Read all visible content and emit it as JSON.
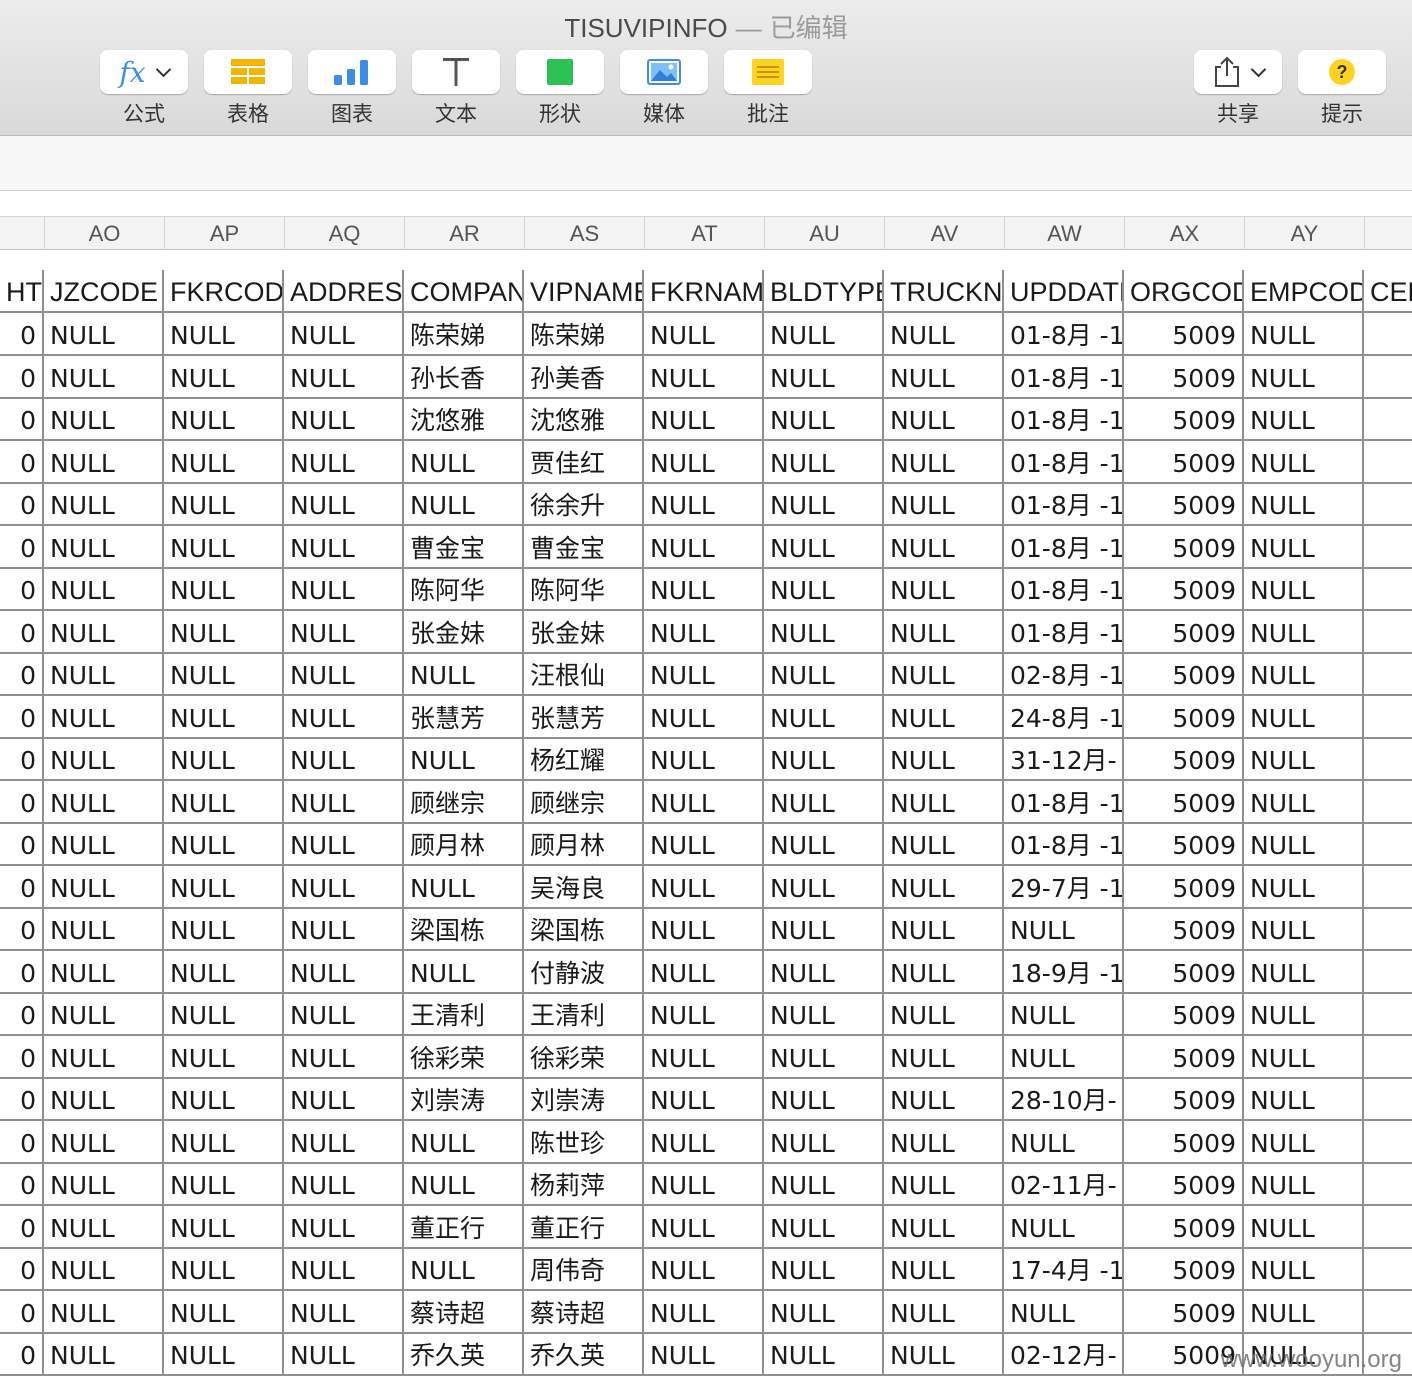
{
  "window": {
    "title": "TISUVIPINFO",
    "separator": "—",
    "status": "已编辑"
  },
  "toolbar": {
    "formula": {
      "icon": "fx-icon",
      "glyph": "fx",
      "label": "公式"
    },
    "table": {
      "icon": "table-icon",
      "label": "表格"
    },
    "chart": {
      "icon": "chart-icon",
      "label": "图表"
    },
    "text": {
      "icon": "text-icon",
      "glyph": "T",
      "label": "文本"
    },
    "shape": {
      "icon": "shape-icon",
      "label": "形状"
    },
    "media": {
      "icon": "media-icon",
      "label": "媒体"
    },
    "comment": {
      "icon": "comment-icon",
      "label": "批注"
    },
    "share": {
      "icon": "share-icon",
      "label": "共享"
    },
    "tips": {
      "icon": "help-icon",
      "glyph": "?",
      "label": "提示"
    }
  },
  "colors": {
    "accent_blue": "#3b8de8",
    "table_orange": "#f5b400",
    "shape_green": "#2ec255",
    "comment_yellow": "#ffd21f",
    "tips_yellow": "#ffd21f"
  },
  "column_letters": [
    "AO",
    "AP",
    "AQ",
    "AR",
    "AS",
    "AT",
    "AU",
    "AV",
    "AW",
    "AX",
    "AY",
    ""
  ],
  "table": {
    "headers": [
      "HT",
      "JZCODE",
      "FKRCODE",
      "ADDRESS",
      "COMPANY",
      "VIPNAME",
      "FKRNAME",
      "BLDTYPE",
      "TRUCKNO",
      "UPDDATE",
      "ORGCODE",
      "EMPCODE",
      "CER"
    ],
    "rows": [
      [
        "0",
        "NULL",
        "NULL",
        "NULL",
        "陈荣娣",
        "陈荣娣",
        "NULL",
        "NULL",
        "NULL",
        "01-8月 -1",
        "5009",
        "NULL",
        ""
      ],
      [
        "0",
        "NULL",
        "NULL",
        "NULL",
        "孙长香",
        "孙美香",
        "NULL",
        "NULL",
        "NULL",
        "01-8月 -1",
        "5009",
        "NULL",
        ""
      ],
      [
        "0",
        "NULL",
        "NULL",
        "NULL",
        "沈悠雅",
        "沈悠雅",
        "NULL",
        "NULL",
        "NULL",
        "01-8月 -1",
        "5009",
        "NULL",
        ""
      ],
      [
        "0",
        "NULL",
        "NULL",
        "NULL",
        "NULL",
        "贾佳红",
        "NULL",
        "NULL",
        "NULL",
        "01-8月 -1",
        "5009",
        "NULL",
        ""
      ],
      [
        "0",
        "NULL",
        "NULL",
        "NULL",
        "NULL",
        "徐余升",
        "NULL",
        "NULL",
        "NULL",
        "01-8月 -1",
        "5009",
        "NULL",
        ""
      ],
      [
        "0",
        "NULL",
        "NULL",
        "NULL",
        "曹金宝",
        "曹金宝",
        "NULL",
        "NULL",
        "NULL",
        "01-8月 -1",
        "5009",
        "NULL",
        ""
      ],
      [
        "0",
        "NULL",
        "NULL",
        "NULL",
        "陈阿华",
        "陈阿华",
        "NULL",
        "NULL",
        "NULL",
        "01-8月 -1",
        "5009",
        "NULL",
        ""
      ],
      [
        "0",
        "NULL",
        "NULL",
        "NULL",
        "张金妹",
        "张金妹",
        "NULL",
        "NULL",
        "NULL",
        "01-8月 -1",
        "5009",
        "NULL",
        ""
      ],
      [
        "0",
        "NULL",
        "NULL",
        "NULL",
        "NULL",
        "汪根仙",
        "NULL",
        "NULL",
        "NULL",
        "02-8月 -1",
        "5009",
        "NULL",
        ""
      ],
      [
        "0",
        "NULL",
        "NULL",
        "NULL",
        "张慧芳",
        "张慧芳",
        "NULL",
        "NULL",
        "NULL",
        "24-8月 -1",
        "5009",
        "NULL",
        ""
      ],
      [
        "0",
        "NULL",
        "NULL",
        "NULL",
        "NULL",
        "杨红耀",
        "NULL",
        "NULL",
        "NULL",
        "31-12月-",
        "5009",
        "NULL",
        ""
      ],
      [
        "0",
        "NULL",
        "NULL",
        "NULL",
        "顾继宗",
        "顾继宗",
        "NULL",
        "NULL",
        "NULL",
        "01-8月 -1",
        "5009",
        "NULL",
        ""
      ],
      [
        "0",
        "NULL",
        "NULL",
        "NULL",
        "顾月林",
        "顾月林",
        "NULL",
        "NULL",
        "NULL",
        "01-8月 -1",
        "5009",
        "NULL",
        ""
      ],
      [
        "0",
        "NULL",
        "NULL",
        "NULL",
        "NULL",
        "吴海良",
        "NULL",
        "NULL",
        "NULL",
        "29-7月 -1",
        "5009",
        "NULL",
        ""
      ],
      [
        "0",
        "NULL",
        "NULL",
        "NULL",
        "梁国栋",
        "梁国栋",
        "NULL",
        "NULL",
        "NULL",
        "NULL",
        "5009",
        "NULL",
        ""
      ],
      [
        "0",
        "NULL",
        "NULL",
        "NULL",
        "NULL",
        "付静波",
        "NULL",
        "NULL",
        "NULL",
        "18-9月 -1",
        "5009",
        "NULL",
        ""
      ],
      [
        "0",
        "NULL",
        "NULL",
        "NULL",
        "王清利",
        "王清利",
        "NULL",
        "NULL",
        "NULL",
        "NULL",
        "5009",
        "NULL",
        ""
      ],
      [
        "0",
        "NULL",
        "NULL",
        "NULL",
        "徐彩荣",
        "徐彩荣",
        "NULL",
        "NULL",
        "NULL",
        "NULL",
        "5009",
        "NULL",
        ""
      ],
      [
        "0",
        "NULL",
        "NULL",
        "NULL",
        "刘崇涛",
        "刘崇涛",
        "NULL",
        "NULL",
        "NULL",
        "28-10月-",
        "5009",
        "NULL",
        ""
      ],
      [
        "0",
        "NULL",
        "NULL",
        "NULL",
        "NULL",
        "陈世珍",
        "NULL",
        "NULL",
        "NULL",
        "NULL",
        "5009",
        "NULL",
        ""
      ],
      [
        "0",
        "NULL",
        "NULL",
        "NULL",
        "NULL",
        "杨莉萍",
        "NULL",
        "NULL",
        "NULL",
        "02-11月-",
        "5009",
        "NULL",
        ""
      ],
      [
        "0",
        "NULL",
        "NULL",
        "NULL",
        "董正行",
        "董正行",
        "NULL",
        "NULL",
        "NULL",
        "NULL",
        "5009",
        "NULL",
        ""
      ],
      [
        "0",
        "NULL",
        "NULL",
        "NULL",
        "NULL",
        "周伟奇",
        "NULL",
        "NULL",
        "NULL",
        "17-4月 -1",
        "5009",
        "NULL",
        ""
      ],
      [
        "0",
        "NULL",
        "NULL",
        "NULL",
        "蔡诗超",
        "蔡诗超",
        "NULL",
        "NULL",
        "NULL",
        "NULL",
        "5009",
        "NULL",
        ""
      ],
      [
        "0",
        "NULL",
        "NULL",
        "NULL",
        "乔久英",
        "乔久英",
        "NULL",
        "NULL",
        "NULL",
        "02-12月-",
        "5009",
        "NULL",
        ""
      ]
    ]
  },
  "watermark": "www.wooyun.org"
}
